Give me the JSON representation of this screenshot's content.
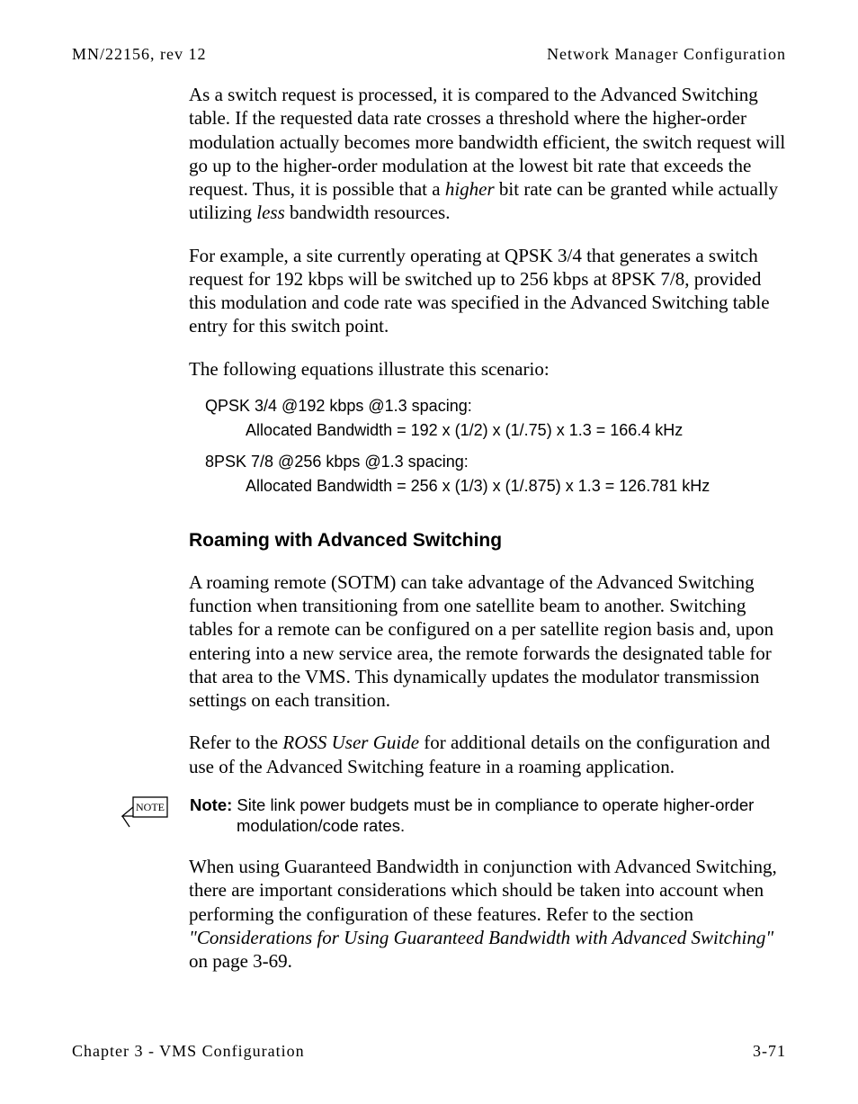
{
  "header": {
    "left": "MN/22156, rev 12",
    "right": "Network Manager Configuration"
  },
  "paragraphs": {
    "p1_a": "As a switch request is processed, it is compared to the Advanced Switching table. If the requested data rate crosses a threshold where the higher-order modulation actually becomes more bandwidth efficient, the switch request will go up to the higher-order modulation at the lowest bit rate that exceeds the request. Thus, it is possible that a ",
    "p1_higher": "higher",
    "p1_b": " bit rate can be granted while actually utilizing ",
    "p1_less": "less",
    "p1_c": " bandwidth resources.",
    "p2": "For example, a site currently operating at QPSK 3/4 that generates a switch request for 192 kbps will be switched up to 256 kbps at 8PSK 7/8, provided this modulation and code rate was specified in the Advanced Switching table entry for this switch point.",
    "p3": "The following equations illustrate this scenario:"
  },
  "calc": {
    "line1": "QPSK 3/4 @192 kbps @1.3 spacing:",
    "line1_sub": "Allocated Bandwidth = 192 x (1/2) x (1/.75) x 1.3 = 166.4 kHz",
    "line2": "8PSK 7/8 @256 kbps @1.3 spacing:",
    "line2_sub": "Allocated Bandwidth = 256 x (1/3) x (1/.875) x 1.3 = 126.781 kHz"
  },
  "section": {
    "heading": "Roaming with Advanced Switching",
    "p1": "A roaming remote (SOTM) can take advantage of the Advanced Switching function when transitioning from one satellite beam to another. Switching tables for a remote can be configured on a per satellite region basis and, upon entering into a new service area, the remote forwards the designated table for that area to the VMS. This dynamically updates the modulator transmission settings on each transition.",
    "p2_a": "Refer to the ",
    "p2_i": "ROSS User Guide",
    "p2_b": " for additional details on the configuration and use of the Advanced Switching feature in a roaming application."
  },
  "note": {
    "icon_label": "NOTE",
    "label": "Note:",
    "text1": "  Site link power budgets must be in compliance to operate higher-order ",
    "text2": "modulation/code rates."
  },
  "closing": {
    "a": "When using Guaranteed Bandwidth in conjunction with Advanced Switching, there are important considerations which should be taken into account when performing the configuration of these features. Refer to the section ",
    "i": "\"Considerations for Using Guaranteed Bandwidth with Advanced Switching\"",
    "b": " on page 3-69."
  },
  "footer": {
    "left": "Chapter 3 - VMS Configuration",
    "right": "3-71"
  }
}
